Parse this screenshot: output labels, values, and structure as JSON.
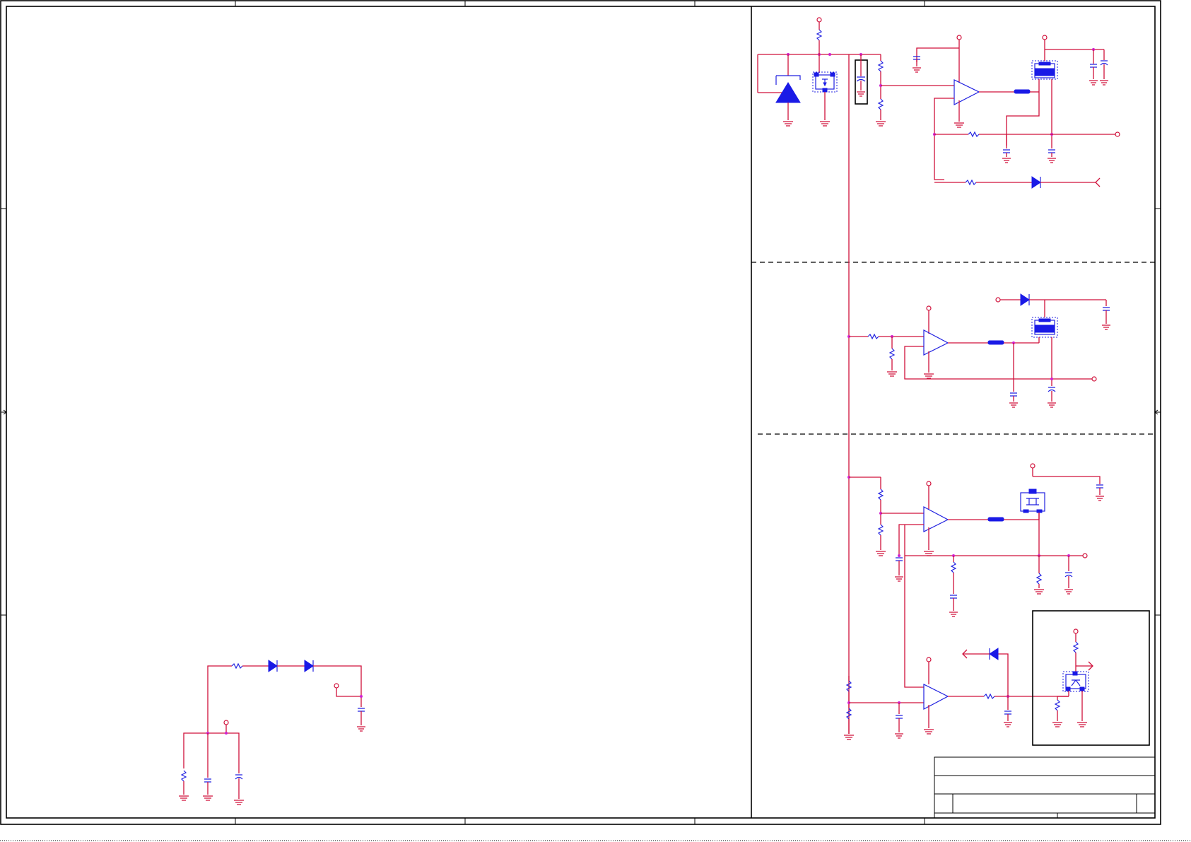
{
  "sheet": {
    "border_color": "#000000",
    "wire_color": "#d0103a",
    "component_color": "#1a1ae6",
    "junction_color": "#d020d0"
  },
  "title_block": {
    "title": "",
    "rev": ""
  }
}
